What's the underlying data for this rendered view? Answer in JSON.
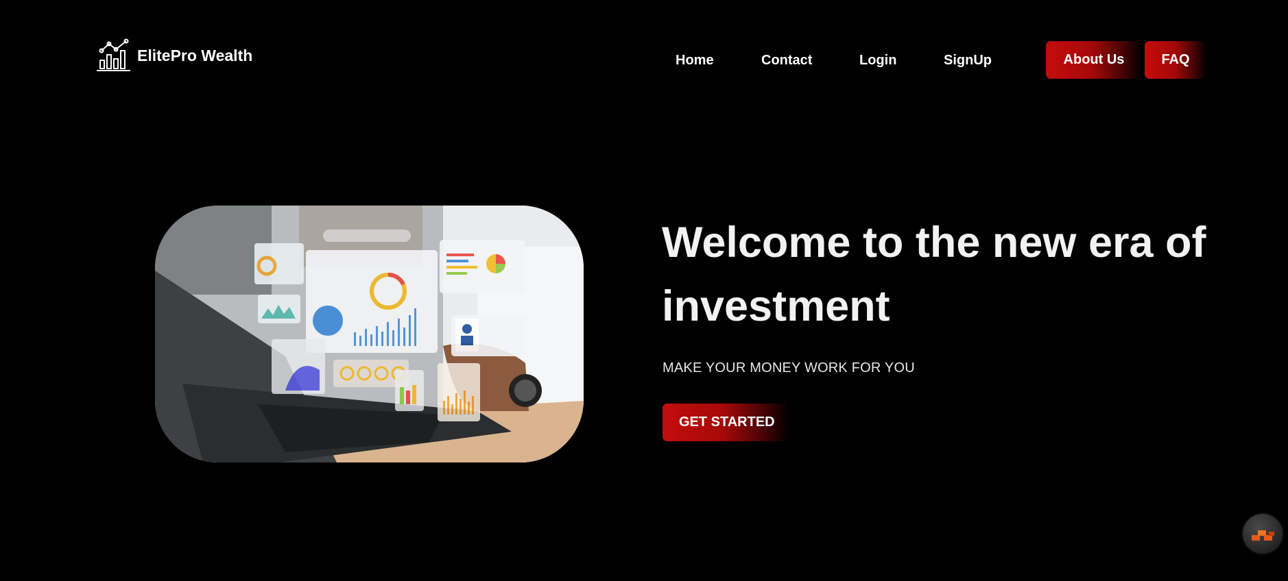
{
  "brand": {
    "name": "ElitePro Wealth",
    "logo_icon": "bar-chart-growth-icon"
  },
  "nav": {
    "links": [
      {
        "label": "Home"
      },
      {
        "label": "Contact"
      },
      {
        "label": "Login"
      },
      {
        "label": "SignUp"
      }
    ],
    "about_label": "About Us",
    "faq_label": "FAQ"
  },
  "hero": {
    "title": "Welcome to the new era of investment",
    "subtitle": "MAKE YOUR MONEY WORK FOR YOU",
    "cta_label": "GET STARTED",
    "image_description_icon": "laptop-analytics-dashboard-image"
  },
  "widget": {
    "icon": "chat-widget-icon"
  },
  "colors": {
    "background": "#000000",
    "accent_red": "#c40c0c",
    "text": "#ffffff"
  }
}
